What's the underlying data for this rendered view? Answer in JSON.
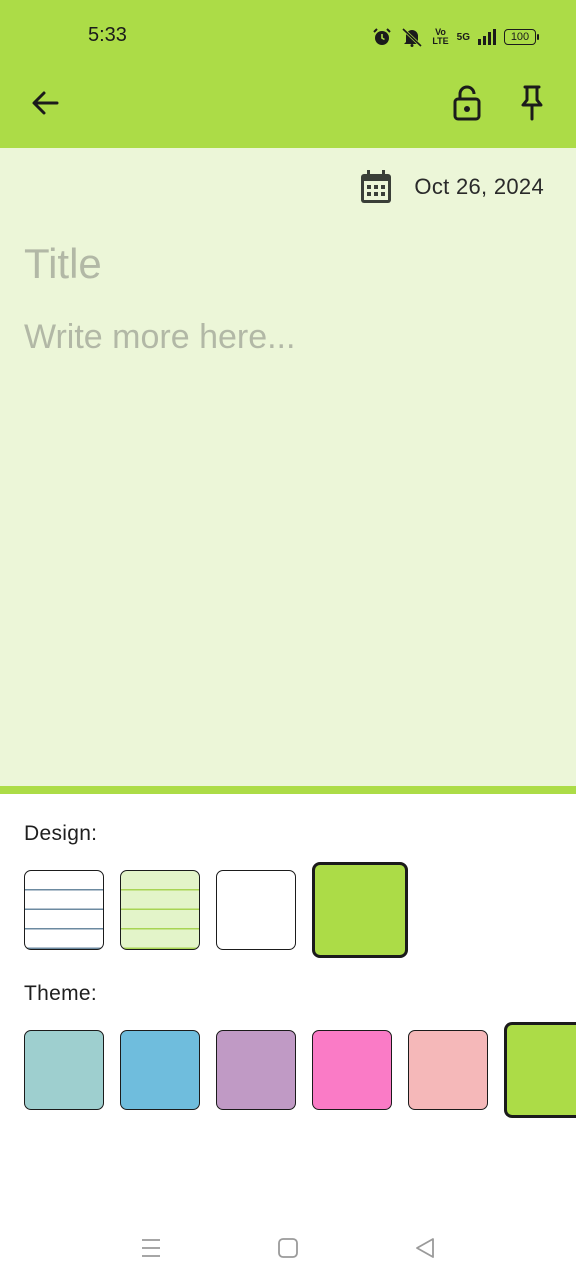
{
  "status_bar": {
    "time": "5:33",
    "icons": [
      "alarm-icon",
      "bell-off-icon",
      "volte-icon",
      "5g-icon",
      "signal-icon",
      "battery-icon"
    ],
    "volte_label": "Vo\nLTE",
    "network_label": "5G",
    "battery_level": "100"
  },
  "app_bar": {
    "back_icon": "arrow-back-icon",
    "lock_icon": "lock-open-icon",
    "pin_icon": "pin-icon",
    "background": "#acdc47"
  },
  "note": {
    "date": "Oct 26, 2024",
    "date_icon": "calendar-icon",
    "title_placeholder": "Title",
    "body_placeholder": "Write more here...",
    "background": "#ecf6d8"
  },
  "design": {
    "label": "Design:",
    "options": [
      {
        "name": "blue-lined",
        "selected": false
      },
      {
        "name": "green-lined",
        "selected": false
      },
      {
        "name": "plain-white",
        "selected": false
      },
      {
        "name": "solid-green",
        "selected": true
      }
    ]
  },
  "theme": {
    "label": "Theme:",
    "colors": [
      "#9ecfcf",
      "#6fbddd",
      "#c09ac5",
      "#fa7bc6",
      "#f5b8b9",
      "#acdc47"
    ],
    "selected_color": "#acdc47"
  },
  "nav_bar": {
    "icons": [
      "menu-icon",
      "home-square-icon",
      "back-triangle-icon"
    ]
  }
}
